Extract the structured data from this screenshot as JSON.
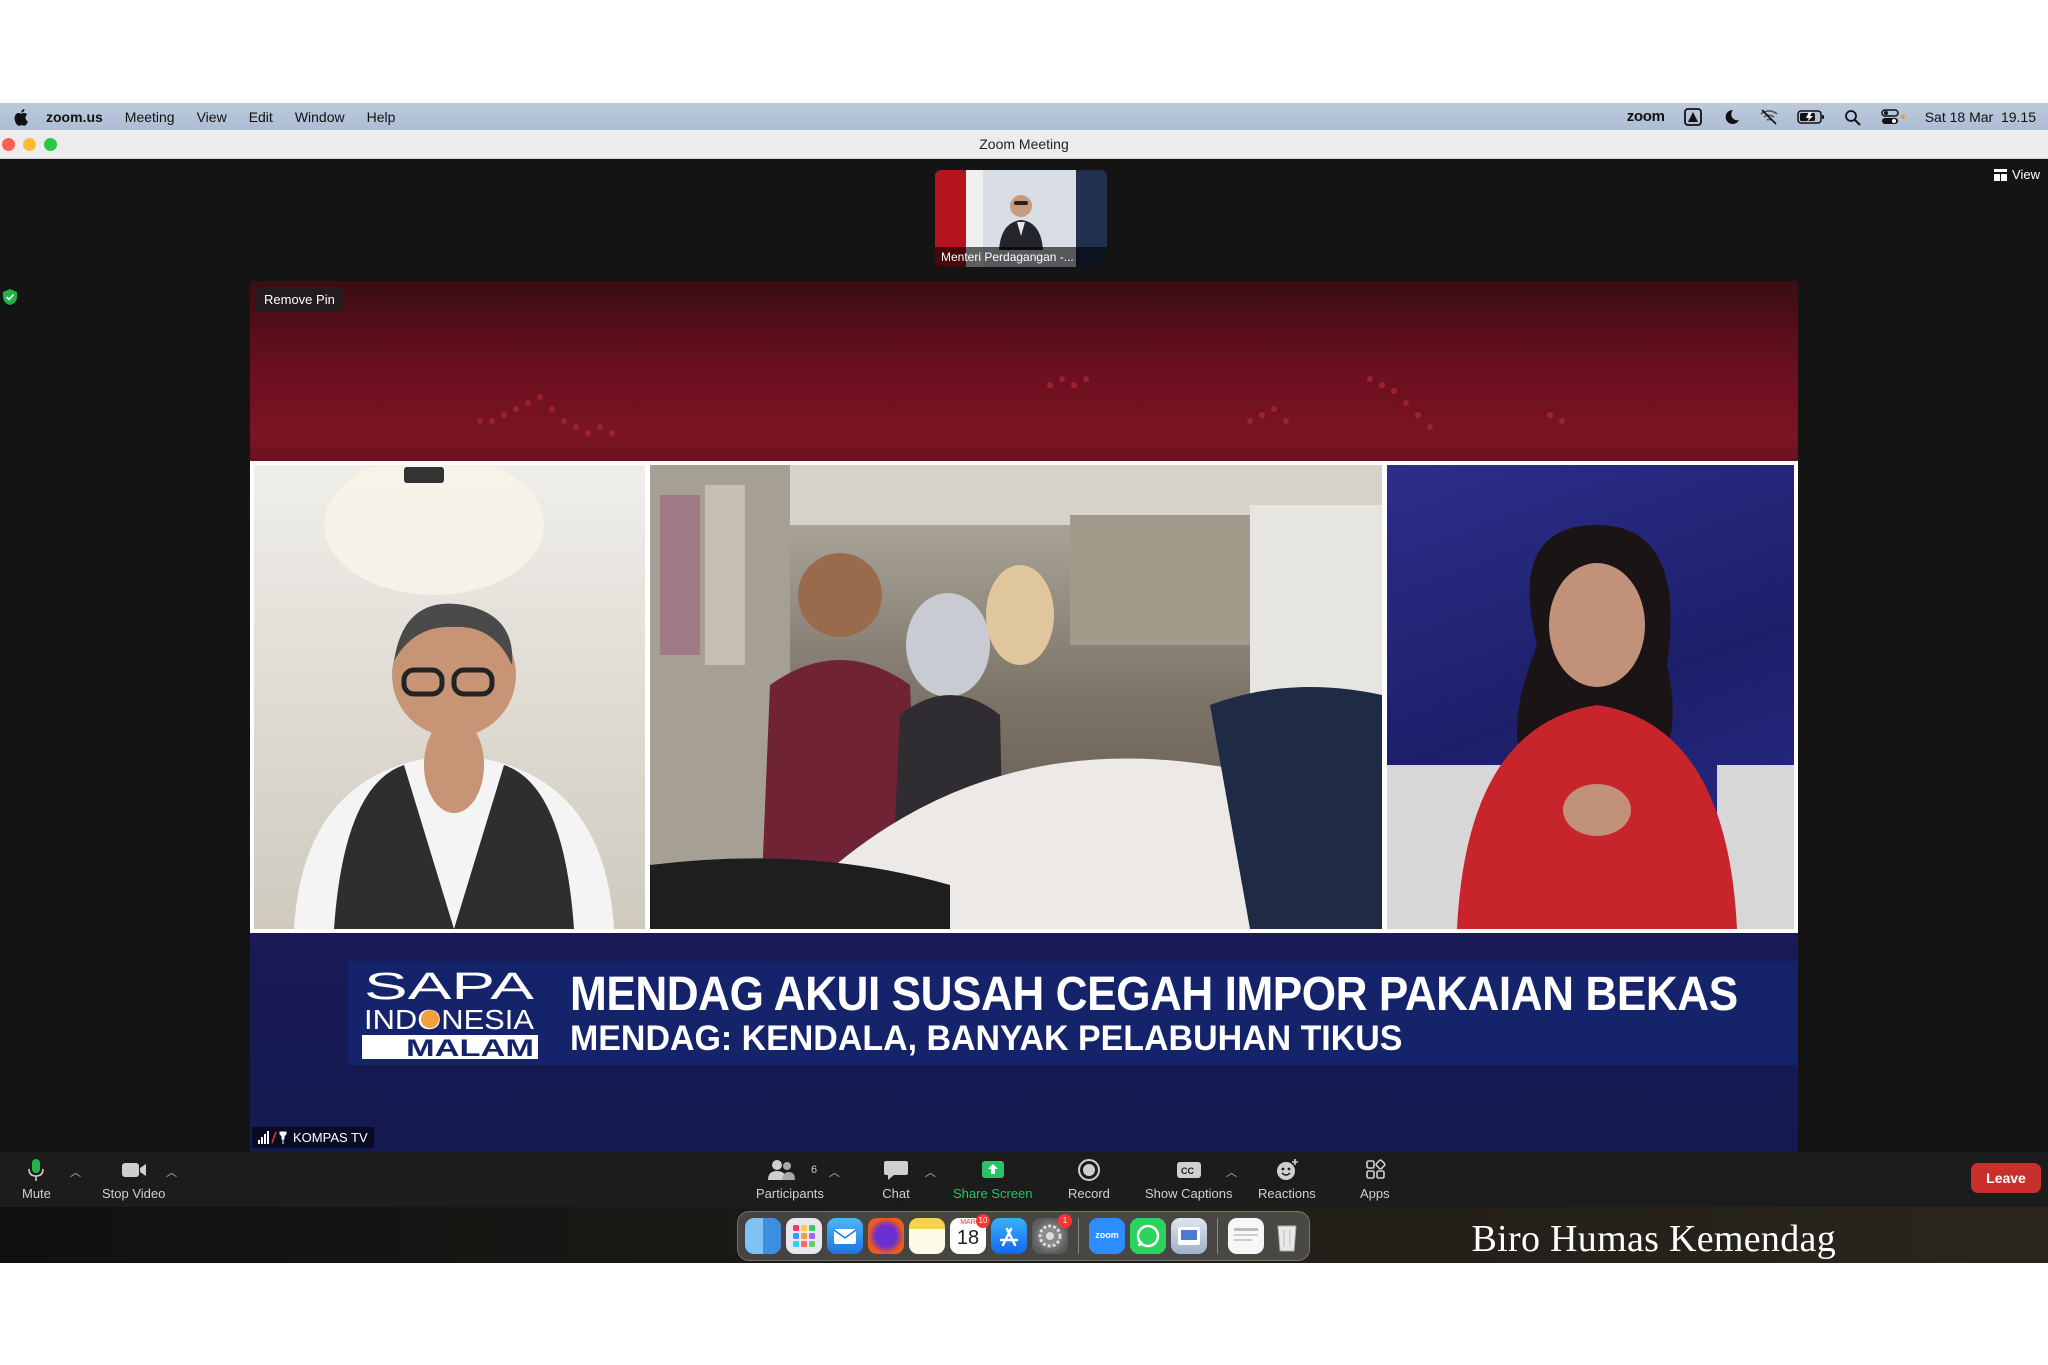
{
  "menubar": {
    "app_name": "zoom.us",
    "items": [
      "Meeting",
      "View",
      "Edit",
      "Window",
      "Help"
    ],
    "zoom_logo": "zoom",
    "datetime": "Sat 18 Mar  19.15",
    "icons": [
      "apple-icon",
      "zoom-status-icon",
      "focus-moon-icon",
      "wifi-off-icon",
      "battery-icon",
      "search-icon",
      "control-center-icon"
    ]
  },
  "window": {
    "title": "Zoom Meeting"
  },
  "meeting": {
    "thumbnail_name": "Menteri Perdagangan -...",
    "view_label": "View",
    "remove_pin_label": "Remove Pin",
    "video_name": "KOMPAS TV"
  },
  "broadcast": {
    "logo_line1": "SAPA",
    "logo_line2": "INDONESIA",
    "logo_line3": "MALAM",
    "headline": "MENDAG AKUI SUSAH CEGAH IMPOR PAKAIAN BEKAS",
    "subheadline": "MENDAG: KENDALA, BANYAK PELABUHAN TIKUS"
  },
  "controls": {
    "mute": "Mute",
    "stop_video": "Stop Video",
    "participants": "Participants",
    "participants_count": "6",
    "chat": "Chat",
    "share_screen": "Share Screen",
    "record": "Record",
    "show_captions": "Show Captions",
    "reactions": "Reactions",
    "apps": "Apps",
    "leave": "Leave",
    "accent_green": "#29c366",
    "leave_red": "#c9302c"
  },
  "dock": {
    "calendar_month": "MAR",
    "calendar_day": "18",
    "calendar_badge": "10",
    "settings_badge": "1",
    "zoom_icon_text": "zoom",
    "apps": [
      "finder",
      "launchpad",
      "mail",
      "firefox",
      "notes",
      "calendar",
      "app-store",
      "system-settings",
      "zoom",
      "whatsapp",
      "preview",
      "document",
      "trash"
    ]
  },
  "watermark": "Biro Humas Kemendag"
}
